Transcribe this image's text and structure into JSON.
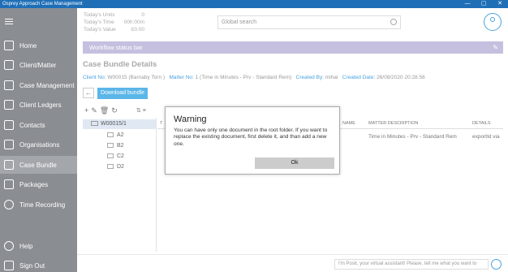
{
  "window": {
    "title": "Osprey Approach Case Management",
    "controls": [
      "—",
      "▢",
      "✕"
    ]
  },
  "sidebar": {
    "items": [
      {
        "label": "Home"
      },
      {
        "label": "Client/Matter"
      },
      {
        "label": "Case Management"
      },
      {
        "label": "Client Ledgers"
      },
      {
        "label": "Contacts"
      },
      {
        "label": "Organisations"
      },
      {
        "label": "Case Bundle"
      },
      {
        "label": "Packages"
      },
      {
        "label": "Time Recording"
      },
      {
        "label": "Help"
      },
      {
        "label": "Sign Out"
      }
    ]
  },
  "stats": {
    "units_label": "Today's Units",
    "units_value": "0",
    "time_label": "Today's Time",
    "time_value": "00h:00m",
    "value_label": "Today's Value",
    "value_value": "£0.00"
  },
  "search": {
    "placeholder": "Global search"
  },
  "workflow": {
    "label": "Workflow status bar"
  },
  "case_bundle": {
    "title": "Case Bundle Details",
    "client_no_label": "Client No:",
    "client_no_value": "W00015 (Barnaby Torn )",
    "matter_no_label": "Matter No:",
    "matter_no_value": "1 (Time in Minutes - Prv - Standard Rem)",
    "created_by_label": "Created By:",
    "created_by_value": "mihai",
    "created_date_label": "Created Date:",
    "created_date_value": "26/08/2020 20:28:56",
    "download_label": "Download bundle",
    "back_label": "←"
  },
  "toolbar": {
    "icons": [
      "+",
      "✎",
      "🗑",
      "↻"
    ],
    "sort_label": "⇅ ≡"
  },
  "tree": {
    "root": "W00015/1",
    "children": [
      "A2",
      "B2",
      "C2",
      "D2"
    ]
  },
  "grid": {
    "headers": [
      "T",
      "NAME",
      "MATTER DESCRIPTION",
      "DETAILS"
    ],
    "row": {
      "matter_description": "Time in Minutes - Prv - Standard Rem",
      "details": "exportId via"
    }
  },
  "assistant": {
    "placeholder": "I'm Posit, your virtual assistant! Please, tell me what you want to"
  },
  "dialog": {
    "title": "Warning",
    "message": "You can have only one document in the root folder. If you want to replace the existing document, first delete it, and than add a new one.",
    "ok_label": "Ok"
  }
}
